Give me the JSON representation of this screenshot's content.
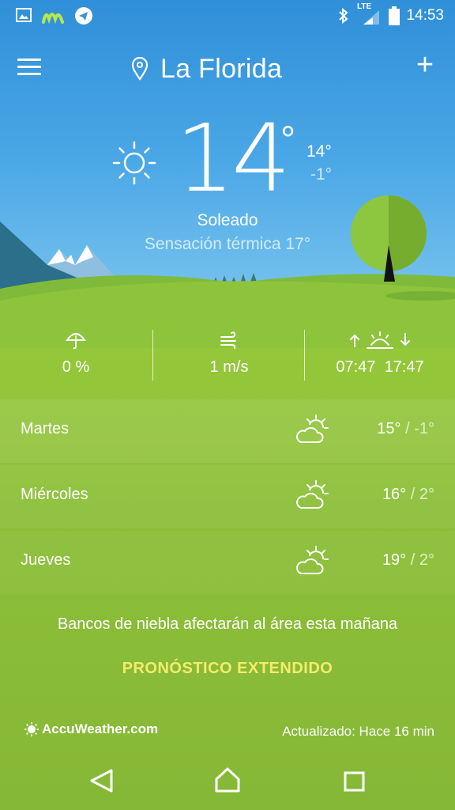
{
  "status_bar": {
    "time": "14:53",
    "network_label": "LTE",
    "icons": [
      "gallery-icon",
      "movistar-logo-icon",
      "telegram-icon",
      "bluetooth-icon",
      "signal-icon",
      "battery-icon"
    ]
  },
  "header": {
    "location": "La Florida",
    "menu_icon": "hamburger-menu-icon",
    "add_icon": "plus-icon",
    "add_label": "+"
  },
  "current": {
    "temp": "14",
    "deg_symbol": "°",
    "high": "14°",
    "low": "-1°",
    "condition": "Soleado",
    "feels_like": "Sensación térmica 17°",
    "icon": "sun-icon"
  },
  "stats": {
    "precip": "0 %",
    "wind": "1 m/s",
    "sunrise": "07:47",
    "sunset": "17:47"
  },
  "forecast": [
    {
      "day": "Martes",
      "high": "15°",
      "low": "-1°",
      "icon": "partly-sunny-icon"
    },
    {
      "day": "Miércoles",
      "high": "16°",
      "low": "2°",
      "icon": "partly-sunny-icon"
    },
    {
      "day": "Jueves",
      "high": "19°",
      "low": "2°",
      "icon": "partly-sunny-icon"
    }
  ],
  "headline": "Bancos de niebla afectarán al área esta mañana",
  "extended_forecast_label": "PRONÓSTICO EXTENDIDO",
  "footer": {
    "provider": "AccuWeather.com",
    "updated": "Actualizado: Hace 16 min"
  },
  "colors": {
    "sky_top": "#2f8fd8",
    "grass": "#8cbf38",
    "accent_link": "#f4ec6a"
  }
}
